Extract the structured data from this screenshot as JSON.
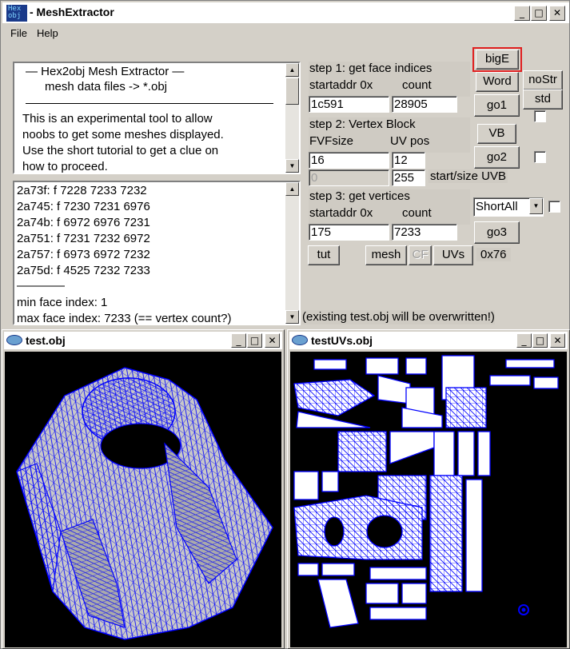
{
  "app": {
    "icon_text": "Hex obj",
    "title": "- MeshExtractor",
    "minimize": "_",
    "maximize": "□",
    "close": "✕"
  },
  "menu": [
    {
      "label": "File"
    },
    {
      "label": "Help"
    }
  ],
  "intro": {
    "line1": "—  Hex2obj Mesh Extractor  —",
    "line2": "mesh data files -> *.obj",
    "para": [
      "This is an experimental tool to allow",
      "noobs to get some meshes displayed.",
      "Use the short tutorial to get a clue on",
      "how to proceed."
    ]
  },
  "log": {
    "lines": [
      "2a73f: f  7228 7233 7232",
      "2a745: f  7230 7231 6976",
      "2a74b: f  6972 6976 7231",
      "2a751: f  7231 7232 6972",
      "2a757: f  6973 6972 7232",
      "2a75d: f  4525 7232 7233",
      "————",
      "min face index: 1",
      "max face index: 7233 (== vertex count?)"
    ]
  },
  "step1": {
    "title": "step 1: get face indices",
    "label_addr": "startaddr 0x",
    "label_count": "count",
    "addr_value": "1c591",
    "count_value": "28905",
    "go_label": "go1"
  },
  "step2": {
    "title": "step 2: Vertex Block",
    "label_fvf": "FVFsize",
    "label_uv": "UV pos",
    "fvf_value": "16",
    "uv_value": "12",
    "uvb_start": "0",
    "uvb_size": "255",
    "uvb_label": "start/size UVB",
    "vb_label": "VB",
    "go_label": "go2"
  },
  "step3": {
    "title": "step 3: get vertices",
    "label_addr": "startaddr 0x",
    "label_count": "count",
    "addr_value": "175",
    "count_value": "7233",
    "select_value": "ShortAll",
    "go_label": "go3"
  },
  "buttons": {
    "bigE": "bigE",
    "word": "Word",
    "noStr": "noStr",
    "std": "std",
    "tut": "tut",
    "mesh": "mesh",
    "cf": "CF",
    "uvs": "UVs",
    "hex": "0x76"
  },
  "status": "(existing test.obj will be overwritten!)",
  "viewer1": {
    "title": "test.obj"
  },
  "viewer2": {
    "title": "testUVs.obj"
  },
  "colors": {
    "wire": "#0000ff",
    "accent": "#e02020"
  }
}
